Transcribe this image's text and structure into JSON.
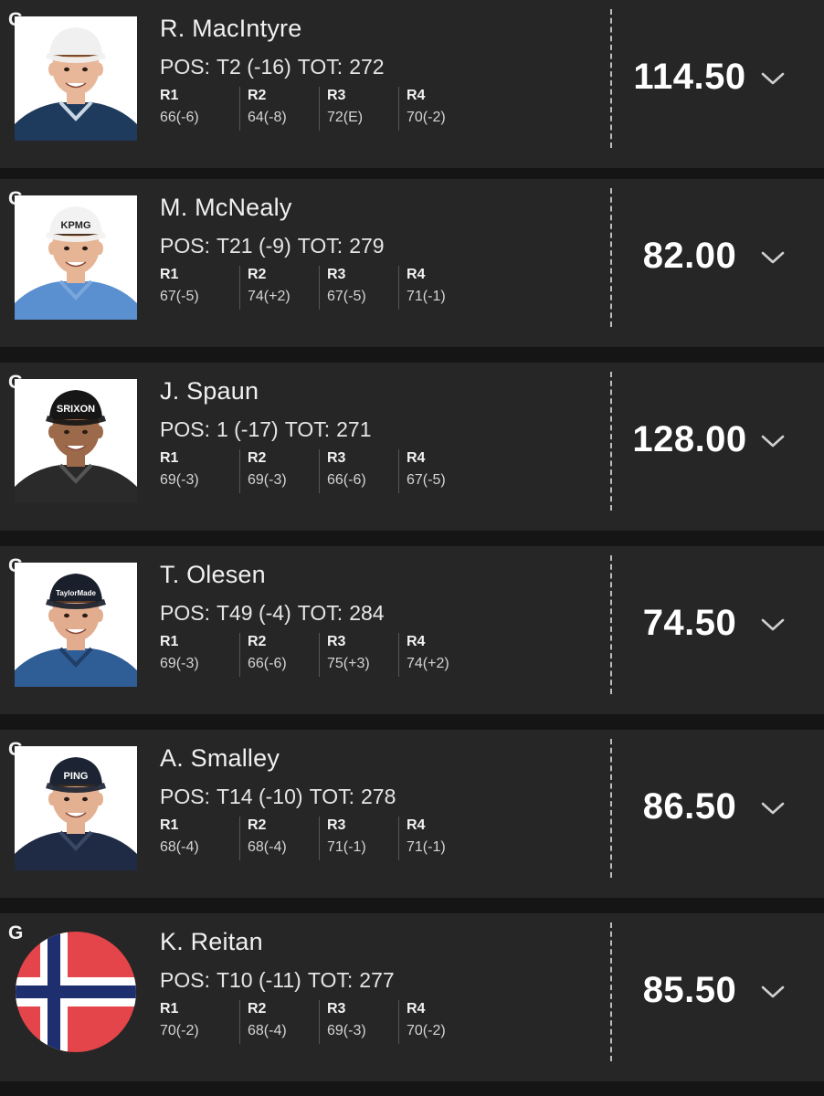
{
  "players": [
    {
      "badge": "G",
      "name": "R. MacIntyre",
      "pos_label": "POS:",
      "pos": "T2 (-16)",
      "tot_label": "TOT:",
      "tot": "272",
      "rounds": [
        {
          "label": "R1",
          "score": "66(-6)"
        },
        {
          "label": "R2",
          "score": "64(-8)"
        },
        {
          "label": "R3",
          "score": "72(E)"
        },
        {
          "label": "R4",
          "score": "70(-2)"
        }
      ],
      "points": "114.50",
      "avatar": {
        "kind": "photo",
        "skin": "#e8b799",
        "hair": "#7a4b2a",
        "cap": "#f0f0f0",
        "cap_text": "",
        "shirt": "#1e3a5c",
        "shirt_accent": "#c9d6e3",
        "bg": "#ffffff"
      }
    },
    {
      "badge": "G",
      "name": "M. McNealy",
      "pos_label": "POS:",
      "pos": "T21 (-9)",
      "tot_label": "TOT:",
      "tot": "279",
      "rounds": [
        {
          "label": "R1",
          "score": "67(-5)"
        },
        {
          "label": "R2",
          "score": "74(+2)"
        },
        {
          "label": "R3",
          "score": "67(-5)"
        },
        {
          "label": "R4",
          "score": "71(-1)"
        }
      ],
      "points": "82.00",
      "avatar": {
        "kind": "photo",
        "skin": "#e6b596",
        "hair": "#4a3322",
        "cap": "#f2f2f2",
        "cap_text": "KPMG",
        "shirt": "#5a8fd0",
        "shirt_accent": "#7aa6dc",
        "bg": "#ffffff"
      }
    },
    {
      "badge": "G",
      "name": "J. Spaun",
      "pos_label": "POS:",
      "pos": "1 (-17)",
      "tot_label": "TOT:",
      "tot": "271",
      "rounds": [
        {
          "label": "R1",
          "score": "69(-3)"
        },
        {
          "label": "R2",
          "score": "69(-3)"
        },
        {
          "label": "R3",
          "score": "66(-6)"
        },
        {
          "label": "R4",
          "score": "67(-5)"
        }
      ],
      "points": "128.00",
      "avatar": {
        "kind": "photo",
        "skin": "#9c6a4a",
        "hair": "#1b1410",
        "cap": "#161616",
        "cap_text": "SRIXON",
        "shirt": "#2a2a2a",
        "shirt_accent": "#555555",
        "bg": "#ffffff"
      }
    },
    {
      "badge": "G",
      "name": "T. Olesen",
      "pos_label": "POS:",
      "pos": "T49 (-4)",
      "tot_label": "TOT:",
      "tot": "284",
      "rounds": [
        {
          "label": "R1",
          "score": "69(-3)"
        },
        {
          "label": "R2",
          "score": "66(-6)"
        },
        {
          "label": "R3",
          "score": "75(+3)"
        },
        {
          "label": "R4",
          "score": "74(+2)"
        }
      ],
      "points": "74.50",
      "avatar": {
        "kind": "photo",
        "skin": "#e2ad8f",
        "hair": "#5a3a24",
        "cap": "#1a1f2c",
        "cap_text": "TaylorMade",
        "shirt": "#2f5d96",
        "shirt_accent": "#203e66",
        "bg": "#ffffff"
      }
    },
    {
      "badge": "G",
      "name": "A. Smalley",
      "pos_label": "POS:",
      "pos": "T14 (-10)",
      "tot_label": "TOT:",
      "tot": "278",
      "rounds": [
        {
          "label": "R1",
          "score": "68(-4)"
        },
        {
          "label": "R2",
          "score": "68(-4)"
        },
        {
          "label": "R3",
          "score": "71(-1)"
        },
        {
          "label": "R4",
          "score": "71(-1)"
        }
      ],
      "points": "86.50",
      "avatar": {
        "kind": "photo",
        "skin": "#e4b092",
        "hair": "#3a2a1e",
        "cap": "#1c2433",
        "cap_text": "PING",
        "shirt": "#1f2b44",
        "shirt_accent": "#3a4866",
        "bg": "#ffffff"
      }
    },
    {
      "badge": "G",
      "name": "K. Reitan",
      "pos_label": "POS:",
      "pos": "T10 (-11)",
      "tot_label": "TOT:",
      "tot": "277",
      "rounds": [
        {
          "label": "R1",
          "score": "70(-2)"
        },
        {
          "label": "R2",
          "score": "68(-4)"
        },
        {
          "label": "R3",
          "score": "69(-3)"
        },
        {
          "label": "R4",
          "score": "70(-2)"
        }
      ],
      "points": "85.50",
      "avatar": {
        "kind": "flag",
        "red": "#e4454a",
        "white": "#ffffff",
        "blue": "#1d2f6e"
      }
    }
  ]
}
